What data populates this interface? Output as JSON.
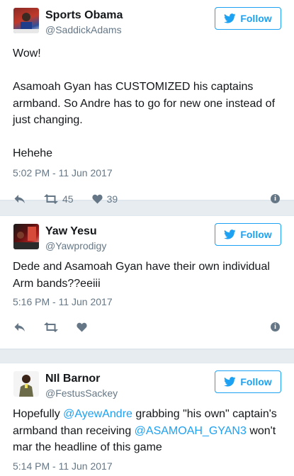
{
  "follow_label": "Follow",
  "tweets": [
    {
      "name": "Sports Obama",
      "handle": "@SaddickAdams",
      "lines": [
        "Wow!",
        "",
        "Asamoah Gyan has CUSTOMIZED his captains",
        "armband. So Andre has to go for new one instead of",
        "just changing.",
        "",
        "Hehehe"
      ],
      "time": "5:02 PM - 11 Jun 2017",
      "retweets": "45",
      "likes": "39"
    },
    {
      "name": "Yaw Yesu",
      "handle": "@Yawprodigy",
      "lines": [
        "Dede and Asamoah Gyan have their own individual",
        "Arm bands??eeiii"
      ],
      "time": "5:16 PM - 11 Jun 2017",
      "retweets": "",
      "likes": ""
    },
    {
      "name": "NIl Barnor",
      "handle": "@FestusSackey",
      "line1_before": "Hopefully ",
      "mention1": "@AyewAndre",
      "line1_after": " grabbing \"his own\" captain's",
      "line2_before": "armband than receiving ",
      "mention2": "@ASAMOAH_GYAN3",
      "line2_after": " won't",
      "line3": "mar the headline of this game",
      "time": "5:14 PM - 11 Jun 2017"
    }
  ],
  "icons": [
    "reply-icon",
    "retweet-icon",
    "like-icon",
    "info-icon",
    "twitter-bird-icon"
  ],
  "colors": {
    "accent": "#1da1f2",
    "muted": "#657786",
    "background": "#e6ecf0"
  }
}
